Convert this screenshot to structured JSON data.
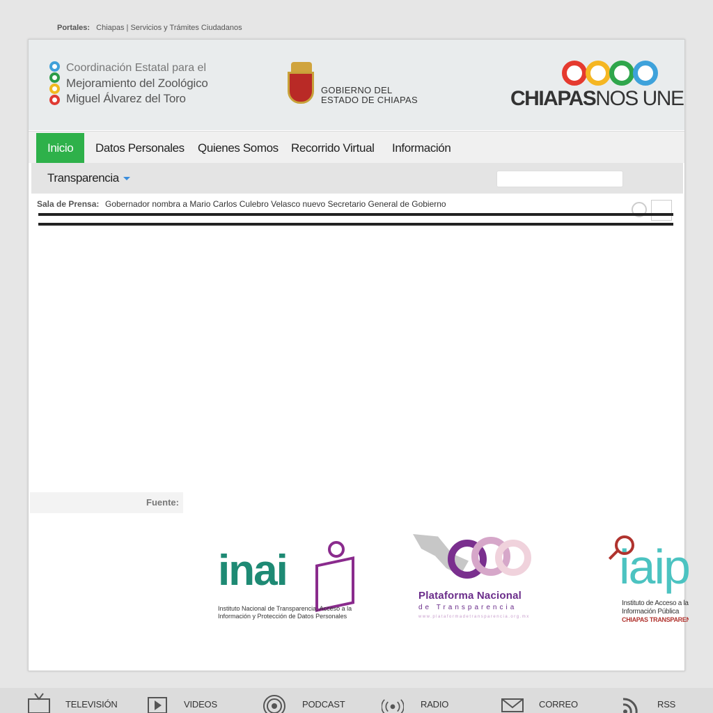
{
  "topbar": {
    "label": "Portales:",
    "links": "Chiapas | Servicios y Trámites Ciudadanos"
  },
  "org": {
    "line1": "Coordinación Estatal para el",
    "line2": "Mejoramiento del Zoológico",
    "line3": "Miguel Álvarez del Toro"
  },
  "gobierno": {
    "line1": "GOBIERNO DEL",
    "line2": "ESTADO DE CHIAPAS"
  },
  "brand": {
    "bold": "CHIAPAS",
    "light": "NOS UNE"
  },
  "nav": {
    "items": [
      "Inicio",
      "Datos Personales",
      "Quienes Somos",
      "Recorrido Virtual",
      "Información"
    ],
    "active": "Inicio"
  },
  "subnav": {
    "transparencia": "Transparencia"
  },
  "search": {
    "value": ""
  },
  "press": {
    "label": "Sala de Prensa:",
    "headline": "Gobernador nombra a Mario Carlos Culebro Velasco nuevo Secretario General de Gobierno"
  },
  "fuente": {
    "label": "Fuente:"
  },
  "logos": {
    "inai": {
      "word": "inai",
      "caption1": "Instituto Nacional de Transparencia, Acceso a la",
      "caption2": "Información y Protección de Datos Personales"
    },
    "pnt": {
      "title": "Plataforma Nacional",
      "subtitle": "de Transparencia",
      "url": "www.plataformadetransparencia.org.mx"
    },
    "iaip": {
      "word": "iaip",
      "caption1": "Instituto de Acceso a la",
      "caption2": "Información Pública",
      "caption3": "CHIAPAS TRANSPARENTE"
    }
  },
  "footer": {
    "items": [
      "TELEVISIÓN",
      "VIDEOS",
      "PODCAST",
      "RADIO",
      "CORREO",
      "RSS"
    ]
  },
  "colors": {
    "accent": "#2eb14a",
    "inai_green": "#1e8a74",
    "inai_purple": "#8a2b8d",
    "pnt_purple": "#6a2c8a",
    "iaip_teal": "#4cc3c1",
    "iaip_red": "#b0332e"
  }
}
